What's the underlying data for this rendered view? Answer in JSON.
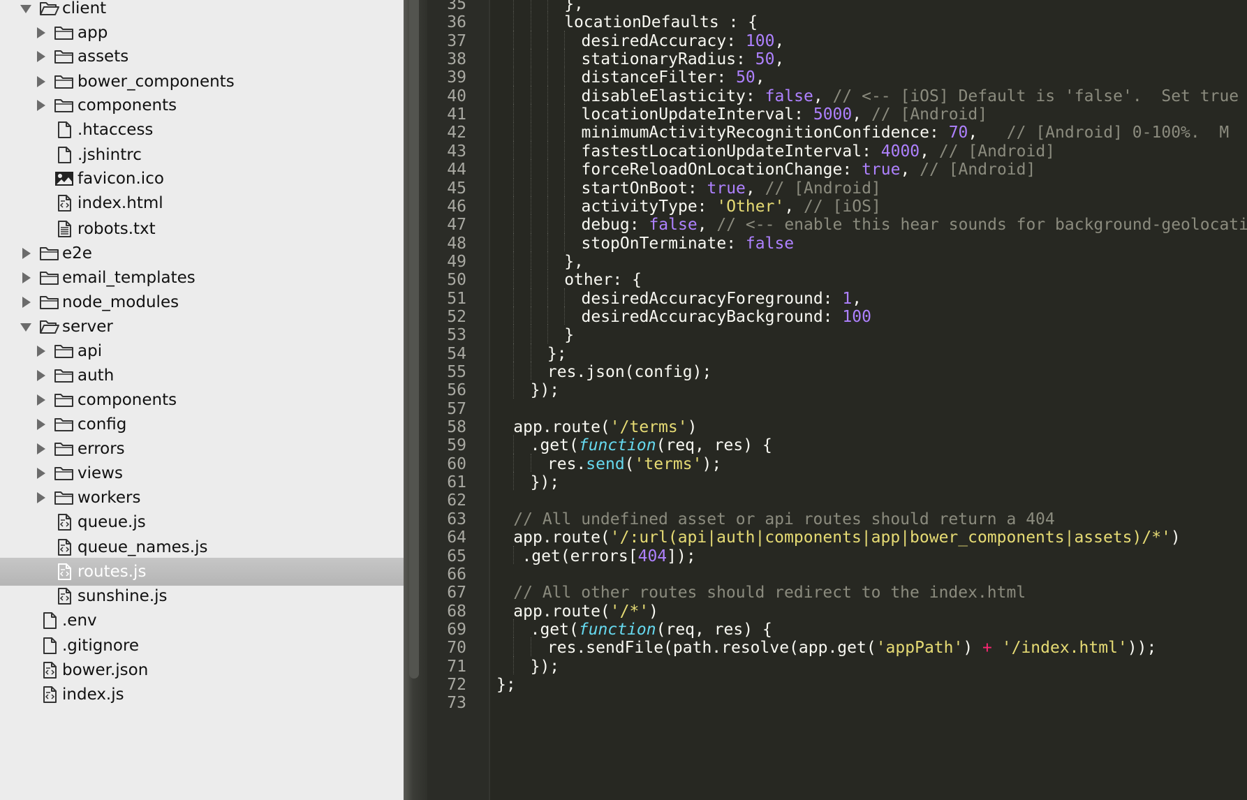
{
  "sidebar": {
    "selected": "routes.js",
    "items": [
      {
        "label": "client",
        "kind": "folder",
        "state": "open",
        "depth": 1
      },
      {
        "label": "app",
        "kind": "folder",
        "state": "closed",
        "depth": 2
      },
      {
        "label": "assets",
        "kind": "folder",
        "state": "closed",
        "depth": 2
      },
      {
        "label": "bower_components",
        "kind": "folder",
        "state": "closed",
        "depth": 2
      },
      {
        "label": "components",
        "kind": "folder",
        "state": "closed",
        "depth": 2
      },
      {
        "label": ".htaccess",
        "kind": "file",
        "depth": 2
      },
      {
        "label": ".jshintrc",
        "kind": "file",
        "depth": 2
      },
      {
        "label": "favicon.ico",
        "kind": "image",
        "depth": 2
      },
      {
        "label": "index.html",
        "kind": "code",
        "depth": 2
      },
      {
        "label": "robots.txt",
        "kind": "text",
        "depth": 2
      },
      {
        "label": "e2e",
        "kind": "folder",
        "state": "closed",
        "depth": 1
      },
      {
        "label": "email_templates",
        "kind": "folder",
        "state": "closed",
        "depth": 1
      },
      {
        "label": "node_modules",
        "kind": "folder",
        "state": "closed",
        "depth": 1
      },
      {
        "label": "server",
        "kind": "folder",
        "state": "open",
        "depth": 1
      },
      {
        "label": "api",
        "kind": "folder",
        "state": "closed",
        "depth": 2
      },
      {
        "label": "auth",
        "kind": "folder",
        "state": "closed",
        "depth": 2
      },
      {
        "label": "components",
        "kind": "folder",
        "state": "closed",
        "depth": 2
      },
      {
        "label": "config",
        "kind": "folder",
        "state": "closed",
        "depth": 2
      },
      {
        "label": "errors",
        "kind": "folder",
        "state": "closed",
        "depth": 2
      },
      {
        "label": "views",
        "kind": "folder",
        "state": "closed",
        "depth": 2
      },
      {
        "label": "workers",
        "kind": "folder",
        "state": "closed",
        "depth": 2
      },
      {
        "label": "queue.js",
        "kind": "code",
        "depth": 2
      },
      {
        "label": "queue_names.js",
        "kind": "code",
        "depth": 2
      },
      {
        "label": "routes.js",
        "kind": "code",
        "depth": 2,
        "selected": true
      },
      {
        "label": "sunshine.js",
        "kind": "code",
        "depth": 2
      },
      {
        "label": ".env",
        "kind": "file",
        "depth": 1
      },
      {
        "label": ".gitignore",
        "kind": "file",
        "depth": 1
      },
      {
        "label": "bower.json",
        "kind": "code",
        "depth": 1
      },
      {
        "label": "index.js",
        "kind": "code",
        "depth": 1
      }
    ]
  },
  "editor": {
    "active_line": 70,
    "colors": {
      "background": "#272822",
      "number": "#ae81ff",
      "string": "#e6db74",
      "comment": "#8b8b7e",
      "keyword": "#66d9ef",
      "operator": "#f92672",
      "text": "#f8f8f2"
    },
    "lines": [
      {
        "n": "35",
        "indent": 8,
        "tokens": [
          [
            "p",
            "},"
          ]
        ]
      },
      {
        "n": "36",
        "indent": 8,
        "tokens": [
          [
            "p",
            "locationDefaults : {"
          ]
        ]
      },
      {
        "n": "37",
        "indent": 10,
        "tokens": [
          [
            "p",
            "desiredAccuracy: "
          ],
          [
            "num",
            "100"
          ],
          [
            "p",
            ","
          ]
        ]
      },
      {
        "n": "38",
        "indent": 10,
        "tokens": [
          [
            "p",
            "stationaryRadius: "
          ],
          [
            "num",
            "50"
          ],
          [
            "p",
            ","
          ]
        ]
      },
      {
        "n": "39",
        "indent": 10,
        "tokens": [
          [
            "p",
            "distanceFilter: "
          ],
          [
            "num",
            "50"
          ],
          [
            "p",
            ","
          ]
        ]
      },
      {
        "n": "40",
        "indent": 10,
        "tokens": [
          [
            "p",
            "disableElasticity: "
          ],
          [
            "num",
            "false"
          ],
          [
            "p",
            ", "
          ],
          [
            "com",
            "// <-- [iOS] Default is 'false'.  Set true"
          ]
        ]
      },
      {
        "n": "41",
        "indent": 10,
        "tokens": [
          [
            "p",
            "locationUpdateInterval: "
          ],
          [
            "num",
            "5000"
          ],
          [
            "p",
            ", "
          ],
          [
            "com",
            "// [Android]"
          ]
        ]
      },
      {
        "n": "42",
        "indent": 10,
        "tokens": [
          [
            "p",
            "minimumActivityRecognitionConfidence: "
          ],
          [
            "num",
            "70"
          ],
          [
            "p",
            ",   "
          ],
          [
            "com",
            "// [Android] 0-100%.  M"
          ]
        ]
      },
      {
        "n": "43",
        "indent": 10,
        "tokens": [
          [
            "p",
            "fastestLocationUpdateInterval: "
          ],
          [
            "num",
            "4000"
          ],
          [
            "p",
            ", "
          ],
          [
            "com",
            "// [Android]"
          ]
        ]
      },
      {
        "n": "44",
        "indent": 10,
        "tokens": [
          [
            "p",
            "forceReloadOnLocationChange: "
          ],
          [
            "num",
            "true"
          ],
          [
            "p",
            ", "
          ],
          [
            "com",
            "// [Android]"
          ]
        ]
      },
      {
        "n": "45",
        "indent": 10,
        "tokens": [
          [
            "p",
            "startOnBoot: "
          ],
          [
            "num",
            "true"
          ],
          [
            "p",
            ", "
          ],
          [
            "com",
            "// [Android]"
          ]
        ]
      },
      {
        "n": "46",
        "indent": 10,
        "tokens": [
          [
            "p",
            "activityType: "
          ],
          [
            "str",
            "'Other'"
          ],
          [
            "p",
            ", "
          ],
          [
            "com",
            "// [iOS]"
          ]
        ]
      },
      {
        "n": "47",
        "indent": 10,
        "tokens": [
          [
            "p",
            "debug: "
          ],
          [
            "num",
            "false"
          ],
          [
            "p",
            ", "
          ],
          [
            "com",
            "// <-- enable this hear sounds for background-geolocation"
          ]
        ]
      },
      {
        "n": "48",
        "indent": 10,
        "tokens": [
          [
            "p",
            "stopOnTerminate: "
          ],
          [
            "num",
            "false"
          ]
        ]
      },
      {
        "n": "49",
        "indent": 8,
        "tokens": [
          [
            "p",
            "},"
          ]
        ]
      },
      {
        "n": "50",
        "indent": 8,
        "tokens": [
          [
            "p",
            "other: {"
          ]
        ]
      },
      {
        "n": "51",
        "indent": 10,
        "tokens": [
          [
            "p",
            "desiredAccuracyForeground: "
          ],
          [
            "num",
            "1"
          ],
          [
            "p",
            ","
          ]
        ]
      },
      {
        "n": "52",
        "indent": 10,
        "tokens": [
          [
            "p",
            "desiredAccuracyBackground: "
          ],
          [
            "num",
            "100"
          ]
        ]
      },
      {
        "n": "53",
        "indent": 8,
        "tokens": [
          [
            "p",
            "}"
          ]
        ]
      },
      {
        "n": "54",
        "indent": 6,
        "tokens": [
          [
            "p",
            "};"
          ]
        ]
      },
      {
        "n": "55",
        "indent": 6,
        "tokens": [
          [
            "p",
            "res.json(config);"
          ]
        ]
      },
      {
        "n": "56",
        "indent": 4,
        "tokens": [
          [
            "p",
            "});"
          ]
        ]
      },
      {
        "n": "57",
        "indent": 0,
        "tokens": []
      },
      {
        "n": "58",
        "indent": 2,
        "tokens": [
          [
            "p",
            "app.route("
          ],
          [
            "str",
            "'/terms'"
          ],
          [
            "p",
            ")"
          ]
        ]
      },
      {
        "n": "59",
        "indent": 4,
        "tokens": [
          [
            "p",
            ".get("
          ],
          [
            "kw",
            "function"
          ],
          [
            "p",
            "(req, res) {"
          ]
        ]
      },
      {
        "n": "60",
        "indent": 6,
        "tokens": [
          [
            "p",
            "res."
          ],
          [
            "fn",
            "send"
          ],
          [
            "p",
            "("
          ],
          [
            "str",
            "'terms'"
          ],
          [
            "p",
            ");"
          ]
        ]
      },
      {
        "n": "61",
        "indent": 4,
        "tokens": [
          [
            "p",
            "});"
          ]
        ]
      },
      {
        "n": "62",
        "indent": 0,
        "tokens": []
      },
      {
        "n": "63",
        "indent": 2,
        "tokens": [
          [
            "com",
            "// All undefined asset or api routes should return a 404"
          ]
        ]
      },
      {
        "n": "64",
        "indent": 2,
        "tokens": [
          [
            "p",
            "app.route("
          ],
          [
            "str",
            "'/:url(api|auth|components|app|bower_components|assets)/*'"
          ],
          [
            "p",
            ")"
          ]
        ]
      },
      {
        "n": "65",
        "indent": 3,
        "tokens": [
          [
            "p",
            ".get(errors["
          ],
          [
            "num",
            "404"
          ],
          [
            "p",
            "]);"
          ]
        ]
      },
      {
        "n": "66",
        "indent": 0,
        "tokens": []
      },
      {
        "n": "67",
        "indent": 2,
        "tokens": [
          [
            "com",
            "// All other routes should redirect to the index.html"
          ]
        ]
      },
      {
        "n": "68",
        "indent": 2,
        "tokens": [
          [
            "p",
            "app.route("
          ],
          [
            "str",
            "'/*'"
          ],
          [
            "p",
            ")"
          ]
        ]
      },
      {
        "n": "69",
        "indent": 4,
        "tokens": [
          [
            "p",
            ".get("
          ],
          [
            "kw",
            "function"
          ],
          [
            "p",
            "(req, res) {"
          ]
        ]
      },
      {
        "n": "70",
        "indent": 6,
        "tokens": [
          [
            "p",
            "res.sendFile(path.resolve(app.get("
          ],
          [
            "str",
            "'appPath'"
          ],
          [
            "p",
            ") "
          ],
          [
            "op",
            "+"
          ],
          [
            "p",
            " "
          ],
          [
            "str",
            "'/index.html'"
          ],
          [
            "p",
            "));"
          ]
        ]
      },
      {
        "n": "71",
        "indent": 4,
        "tokens": [
          [
            "p",
            "});"
          ]
        ]
      },
      {
        "n": "72",
        "indent": 0,
        "tokens": [
          [
            "p",
            "};"
          ]
        ]
      },
      {
        "n": "73",
        "indent": 0,
        "tokens": []
      }
    ]
  }
}
